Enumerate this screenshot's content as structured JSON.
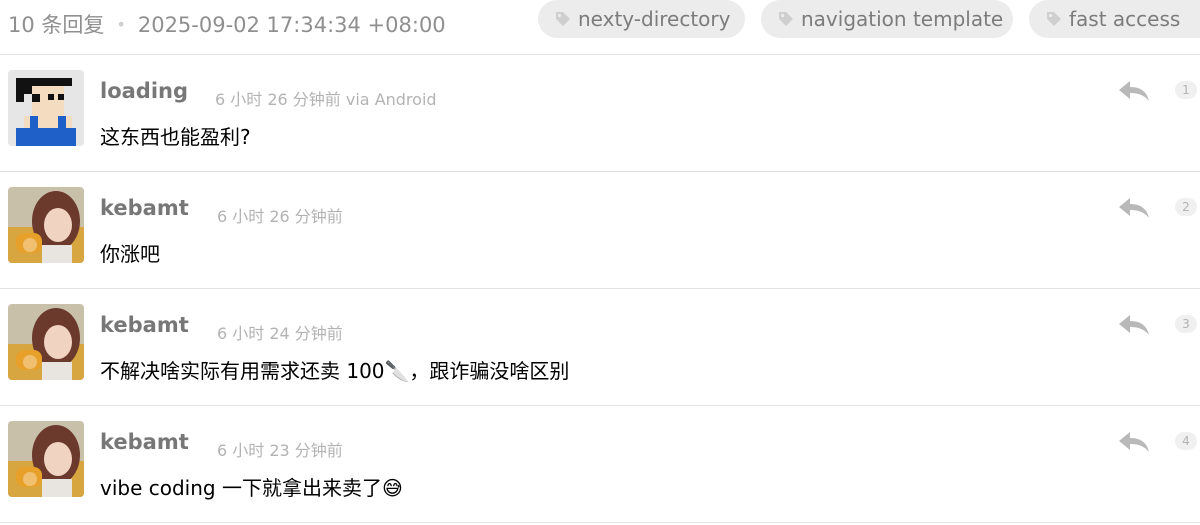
{
  "header": {
    "reply_count": "10 条回复",
    "separator": "•",
    "timestamp": "2025-09-02 17:34:34 +08:00",
    "tags": [
      "nexty-directory",
      "navigation template",
      "fast access"
    ]
  },
  "replies": [
    {
      "user": "loading",
      "time": "6 小时 26 分钟前 via Android",
      "content": "这东西也能盈利?",
      "floor": "1",
      "avatar": "pixel-avatar"
    },
    {
      "user": "kebamt",
      "time": "6 小时 26 分钟前",
      "content": "你涨吧",
      "floor": "2",
      "avatar": "photo-avatar"
    },
    {
      "user": "kebamt",
      "time": "6 小时 24 分钟前",
      "content": "不解决啥实际有用需求还卖 100🔪，跟诈骗没啥区别",
      "floor": "3",
      "avatar": "photo-avatar"
    },
    {
      "user": "kebamt",
      "time": "6 小时 23 分钟前",
      "content": "vibe coding 一下就拿出来卖了😅",
      "floor": "4",
      "avatar": "photo-avatar"
    }
  ],
  "colors": {
    "tag_bg": "#ececec",
    "tag_text": "#7c7c7c",
    "username": "#777777",
    "meta": "#b3b3b3",
    "divider": "#e2e2e2"
  }
}
